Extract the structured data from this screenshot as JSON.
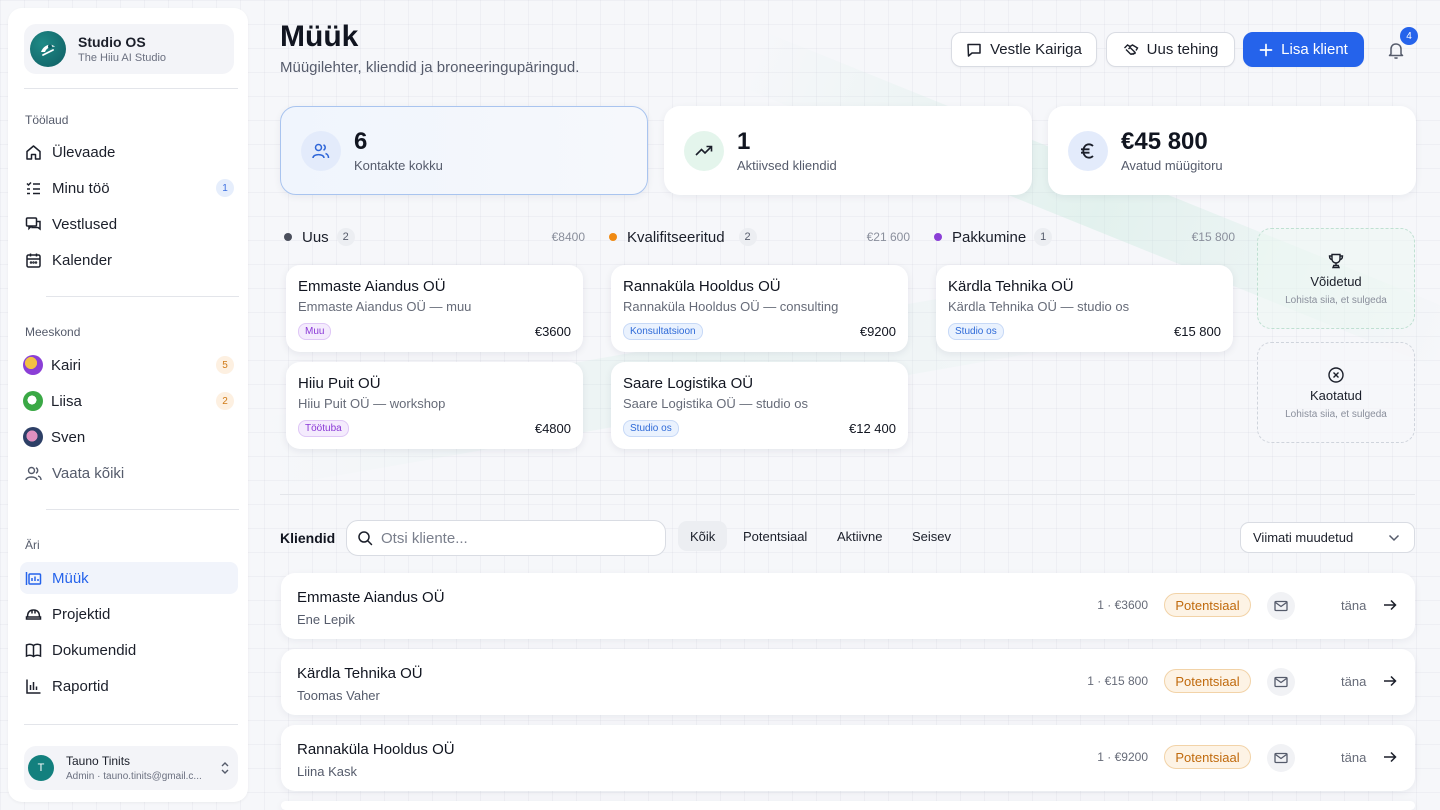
{
  "brand": {
    "title": "Studio OS",
    "subtitle": "The Hiiu AI Studio"
  },
  "sidebar": {
    "workspace_label": "Töölaud",
    "workspace_items": [
      {
        "label": "Ülevaade",
        "icon": "home-icon"
      },
      {
        "label": "Minu töö",
        "icon": "task-list-icon",
        "badge": "1"
      },
      {
        "label": "Vestlused",
        "icon": "chat-icon"
      },
      {
        "label": "Kalender",
        "icon": "calendar-icon"
      }
    ],
    "team_label": "Meeskond",
    "team_items": [
      {
        "label": "Kairi",
        "badge": "5",
        "avatar_color": "#8b3fd6"
      },
      {
        "label": "Liisa",
        "badge": "2",
        "avatar_color": "#3aa845"
      },
      {
        "label": "Sven",
        "avatar_color": "#2d3f66"
      },
      {
        "label": "Vaata kõiki",
        "icon": "users-icon"
      }
    ],
    "business_label": "Äri",
    "business_items": [
      {
        "label": "Müük",
        "icon": "sales-icon",
        "active": true
      },
      {
        "label": "Projektid",
        "icon": "helmet-icon"
      },
      {
        "label": "Dokumendid",
        "icon": "book-icon"
      },
      {
        "label": "Raportid",
        "icon": "bar-chart-icon"
      }
    ],
    "user": {
      "initial": "T",
      "name": "Tauno Tinits",
      "email": "Admin · tauno.tinits@gmail.c..."
    }
  },
  "header": {
    "title": "Müük",
    "subtitle": "Müügilehter, kliendid ja broneeringupäringud.",
    "buttons": {
      "chat": "Vestle Kairiga",
      "new_deal": "Uus tehing",
      "add_client": "Lisa klient"
    },
    "notifications_count": "4"
  },
  "stats": [
    {
      "value": "6",
      "label": "Kontakte kokku"
    },
    {
      "value": "1",
      "label": "Aktiivsed kliendid"
    },
    {
      "value": "€45 800",
      "label": "Avatud müügitoru"
    }
  ],
  "pipeline": {
    "columns": [
      {
        "title": "Uus",
        "count": "2",
        "total": "€8400",
        "color": "#4b4f5c",
        "deals": [
          {
            "name": "Emmaste Aiandus OÜ",
            "desc": "Emmaste Aiandus OÜ — muu",
            "tag": "Muu",
            "amount": "€3600"
          },
          {
            "name": "Hiiu Puit OÜ",
            "desc": "Hiiu Puit OÜ — workshop",
            "tag": "Töötuba",
            "amount": "€4800"
          }
        ]
      },
      {
        "title": "Kvalifitseeritud",
        "count": "2",
        "total": "€21 600",
        "color": "#f08a13",
        "deals": [
          {
            "name": "Rannaküla Hooldus OÜ",
            "desc": "Rannaküla Hooldus OÜ — consulting",
            "tag": "Konsultatsioon",
            "amount": "€9200"
          },
          {
            "name": "Saare Logistika OÜ",
            "desc": "Saare Logistika OÜ — studio os",
            "tag": "Studio os",
            "amount": "€12 400"
          }
        ]
      },
      {
        "title": "Pakkumine",
        "count": "1",
        "total": "€15 800",
        "color": "#8b3fd6",
        "deals": [
          {
            "name": "Kärdla Tehnika OÜ",
            "desc": "Kärdla Tehnika OÜ — studio os",
            "tag": "Studio os",
            "amount": "€15 800"
          }
        ]
      }
    ],
    "won": {
      "title": "Võidetud",
      "hint": "Lohista siia, et sulgeda"
    },
    "lost": {
      "title": "Kaotatud",
      "hint": "Lohista siia, et sulgeda"
    }
  },
  "clients": {
    "label": "Kliendid",
    "search_placeholder": "Otsi kliente...",
    "filters": [
      "Kõik",
      "Potentsiaal",
      "Aktiivne",
      "Seisev"
    ],
    "sort": "Viimati muudetud",
    "rows": [
      {
        "name": "Emmaste Aiandus OÜ",
        "contact": "Ene Lepik",
        "meta": "1 · €3600",
        "status": "Potentsiaal",
        "when": "täna"
      },
      {
        "name": "Kärdla Tehnika OÜ",
        "contact": "Toomas Vaher",
        "meta": "1 · €15 800",
        "status": "Potentsiaal",
        "when": "täna"
      },
      {
        "name": "Rannaküla Hooldus OÜ",
        "contact": "Liina Kask",
        "meta": "1 · €9200",
        "status": "Potentsiaal",
        "when": "täna"
      }
    ]
  },
  "colors": {
    "accent": "#2563eb",
    "sidebar_active": "#2563eb",
    "status_potential": "#c06a0d"
  }
}
